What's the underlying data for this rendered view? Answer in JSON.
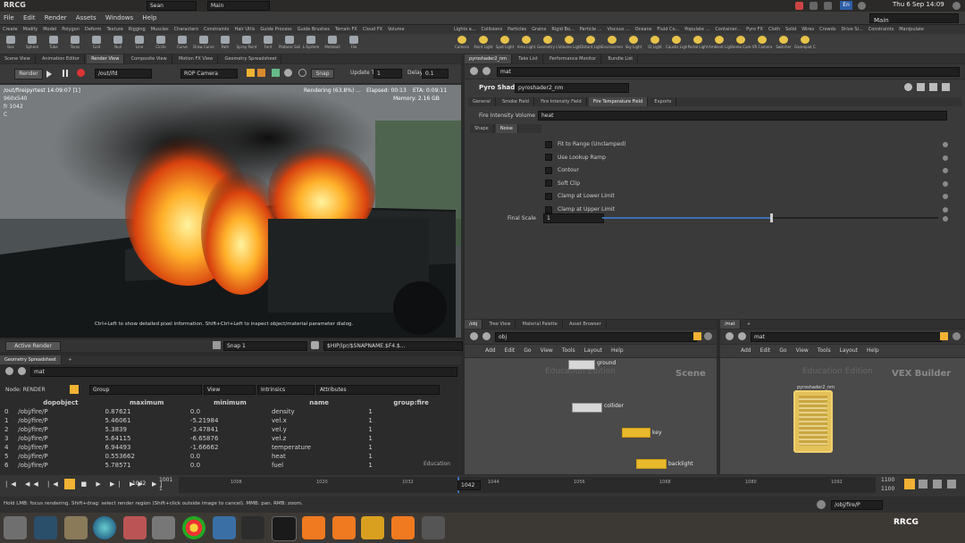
{
  "system": {
    "clock": "Thu 6 Sep 14:09",
    "session": "Sean",
    "desktop": "Main",
    "watermark": "RRCG"
  },
  "menu": [
    "File",
    "Edit",
    "Render",
    "Assets",
    "Windows",
    "Help"
  ],
  "desk_dropdown": "Main",
  "shelf_tabs_left": [
    "Create",
    "Modify",
    "Model",
    "Polygon",
    "Deform",
    "Texture",
    "Rigging",
    "Muscles",
    "Characters",
    "Constraints",
    "Hair Utils",
    "Guide Process",
    "Guide Brushes",
    "Terrain FX",
    "Cloud FX",
    "Volume"
  ],
  "shelf_tabs_right": [
    "Lights a...",
    "Collisions",
    "Particles",
    "Grains",
    "Rigid Bo...",
    "Particle ...",
    "Viscous ...",
    "Oceans",
    "Fluid Co...",
    "Populate ...",
    "Container...",
    "Pyro FX",
    "Cloth",
    "Solid",
    "Wires",
    "Crowds",
    "Drive Si...",
    "Constraints",
    "Manipulate"
  ],
  "shelf_tools_left": [
    "Box",
    "Sphere",
    "Tube",
    "Torus",
    "Grid",
    "Null",
    "Line",
    "Circle",
    "Curve",
    "Draw Curve",
    "Path",
    "Spray Paint",
    "Font",
    "Platonic Solids",
    "L-System",
    "Metaball",
    "File"
  ],
  "shelf_tools_right": [
    "Camera",
    "Point Light",
    "Spot Light",
    "Area Light",
    "Geometry Light",
    "Volume Light",
    "Distant Light",
    "Environment Light",
    "Sky Light",
    "GI Light",
    "Caustic Light",
    "Portal Light",
    "Ambient Light",
    "Stereo Camera",
    "VR Camera",
    "Switcher",
    "Gamepad Camera"
  ],
  "left_tabs": [
    "Scene View",
    "Animation Editor",
    "Render View",
    "Composite View",
    "Motion FX View",
    "Geometry Spreadsheet"
  ],
  "render_bar": {
    "render_btn": "Render",
    "path": "/out/ifd",
    "camera": "ROP Camera",
    "snap": "Snap",
    "update_label": "Update Time",
    "update_value": "1",
    "delay_label": "Delay",
    "delay_value": "0.1"
  },
  "viewport": {
    "path": "/out/fireipyrtest 14:09:07 [1]",
    "res": "960x540",
    "frame": "fr 1042",
    "channel": "C",
    "rendering": "Rendering (63.8%) ...",
    "elapsed": "Elapsed: 00:13",
    "eta": "ETA: 0:09:11",
    "memory": "Memory: 2.16 GB",
    "hint": "Ctrl+Left to show detailed pixel information. Shift+Ctrl+Left to inspect object/material parameter dialog."
  },
  "vp_bottom": {
    "active_render": "Active Render",
    "snap": "Snap 1",
    "ipr_path": "$HIP/ipr/$SNAPNAME.$F4.$..."
  },
  "spreadsheet": {
    "tab": "Geometry Spreadsheet",
    "path": "mat",
    "node_label": "Node: RENDER",
    "group": "Group",
    "view": "View",
    "intrinsics": "Intrinsics",
    "attributes": "Attributes",
    "headers": [
      "",
      "dopobject",
      "maximum",
      "minimum",
      "name",
      "group:fire"
    ],
    "rows": [
      [
        "0",
        "/obj/fire/P",
        "0.87621",
        "0.0",
        "density",
        "1"
      ],
      [
        "1",
        "/obj/fire/P",
        "5.46061",
        "-5.21984",
        "vel.x",
        "1"
      ],
      [
        "2",
        "/obj/fire/P",
        "5.3839",
        "-3.47841",
        "vel.y",
        "1"
      ],
      [
        "3",
        "/obj/fire/P",
        "5.64115",
        "-6.65876",
        "vel.z",
        "1"
      ],
      [
        "4",
        "/obj/fire/P",
        "6.94493",
        "-1.66662",
        "temperature",
        "1"
      ],
      [
        "5",
        "/obj/fire/P",
        "0.553662",
        "0.0",
        "heat",
        "1"
      ],
      [
        "6",
        "/obj/fire/P",
        "5.78571",
        "0.0",
        "fuel",
        "1"
      ]
    ],
    "edition": "Education"
  },
  "right_tabs": [
    "pyroshader2_nm",
    "Take List",
    "Performance Monitor",
    "Bundle List"
  ],
  "param_path": "mat",
  "param_header": {
    "type": "Pyro Shader",
    "name": "pyroshader2_nm"
  },
  "param_tabs": [
    "General",
    "Smoke Field",
    "Fire Intensity Field",
    "Fire Temperature Field",
    "Exports"
  ],
  "fire_intensity": {
    "label": "Fire Intensity Volume",
    "value": "heat"
  },
  "sub_tabs": [
    "Shape",
    "Noise"
  ],
  "checkboxes": [
    "Fit to Range (Unclamped)",
    "Use Lookup Ramp",
    "Contour",
    "Soft Clip",
    "Clamp at Lower Limit",
    "Clamp at Upper Limit"
  ],
  "final_scale": {
    "label": "Final Scale",
    "value": "1",
    "fraction": 0.5
  },
  "net_left": {
    "tabs": [
      "/obj",
      "Tree View",
      "Material Palette",
      "Asset Browser"
    ],
    "path": "obj",
    "menu": [
      "Add",
      "Edit",
      "Go",
      "View",
      "Tools",
      "Layout",
      "Help"
    ],
    "edition": "Education Edition",
    "context": "Scene",
    "nodes": [
      "ground",
      "collider",
      "key",
      "backlight"
    ]
  },
  "net_right": {
    "tabs": [
      "/mat"
    ],
    "path": "mat",
    "menu": [
      "Add",
      "Edit",
      "Go",
      "View",
      "Tools",
      "Layout",
      "Help"
    ],
    "edition": "Education Edition",
    "context": "VEX Builder",
    "node": "pyroshader2_nm"
  },
  "timeline": {
    "current": "1042",
    "start": "1",
    "end": "1100",
    "range_start": "1001",
    "range_end": "1100",
    "ticks": [
      "1008",
      "1020",
      "1032",
      "1044",
      "1056",
      "1068",
      "1080",
      "1092"
    ]
  },
  "statusbar": {
    "text": "Hold LMB: focus rendering. Shift+drag: select render region (Shift+click outside image to cancel). MMB: pan. RMB: zoom.",
    "path": "/obj/fire/P"
  },
  "colors": {
    "accent": "#f2b233",
    "node_yellow": "#e8b92c",
    "bg": "#2b2b2b",
    "panel": "#3a3a3a"
  }
}
